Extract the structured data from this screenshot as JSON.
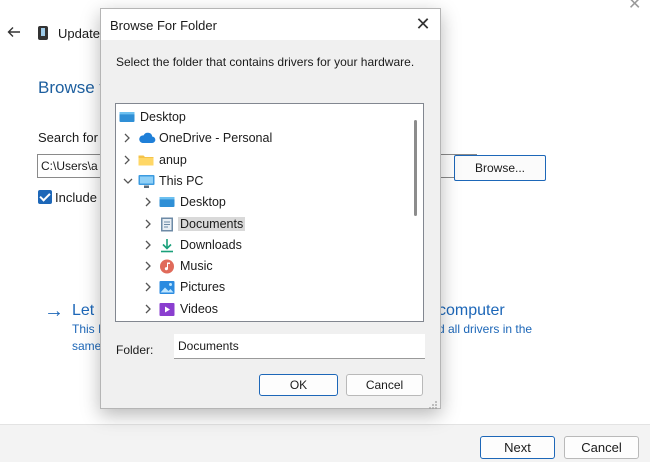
{
  "background": {
    "title": "Update",
    "heading": "Browse f",
    "search_label": "Search for d",
    "path_value": "C:\\Users\\a",
    "browse_label": "Browse...",
    "include_label": "Include",
    "let_text": "Let",
    "computer_text": "computer",
    "desc_line1": "This I",
    "desc_line2": "same",
    "desc_right": "d all drivers in the",
    "next_label": "Next",
    "cancel_label": "Cancel",
    "top_close": "✕"
  },
  "dialog": {
    "title": "Browse For Folder",
    "close_glyph": "✕",
    "instruction": "Select the folder that contains drivers for your hardware.",
    "tree": [
      {
        "label": "Desktop",
        "icon": "desktop-folder-icon",
        "chevron": "none"
      },
      {
        "label": "OneDrive - Personal",
        "icon": "cloud-icon",
        "chevron": "collapsed"
      },
      {
        "label": "anup",
        "icon": "user-folder-icon",
        "chevron": "collapsed"
      },
      {
        "label": "This PC",
        "icon": "computer-icon",
        "chevron": "expanded"
      },
      {
        "label": "Desktop",
        "icon": "desktop-folder-icon",
        "chevron": "collapsed"
      },
      {
        "label": "Documents",
        "icon": "documents-icon",
        "chevron": "collapsed",
        "selected": true
      },
      {
        "label": "Downloads",
        "icon": "download-icon",
        "chevron": "collapsed"
      },
      {
        "label": "Music",
        "icon": "music-icon",
        "chevron": "collapsed"
      },
      {
        "label": "Pictures",
        "icon": "pictures-icon",
        "chevron": "collapsed"
      },
      {
        "label": "Videos",
        "icon": "videos-icon",
        "chevron": "collapsed"
      }
    ],
    "folder_label": "Folder:",
    "folder_value": "Documents",
    "ok_label": "OK",
    "cancel_label": "Cancel"
  },
  "colors": {
    "accent": "#1d67b8",
    "selection": "#d9d9d9",
    "dialog_body": "#f0f0f0"
  }
}
